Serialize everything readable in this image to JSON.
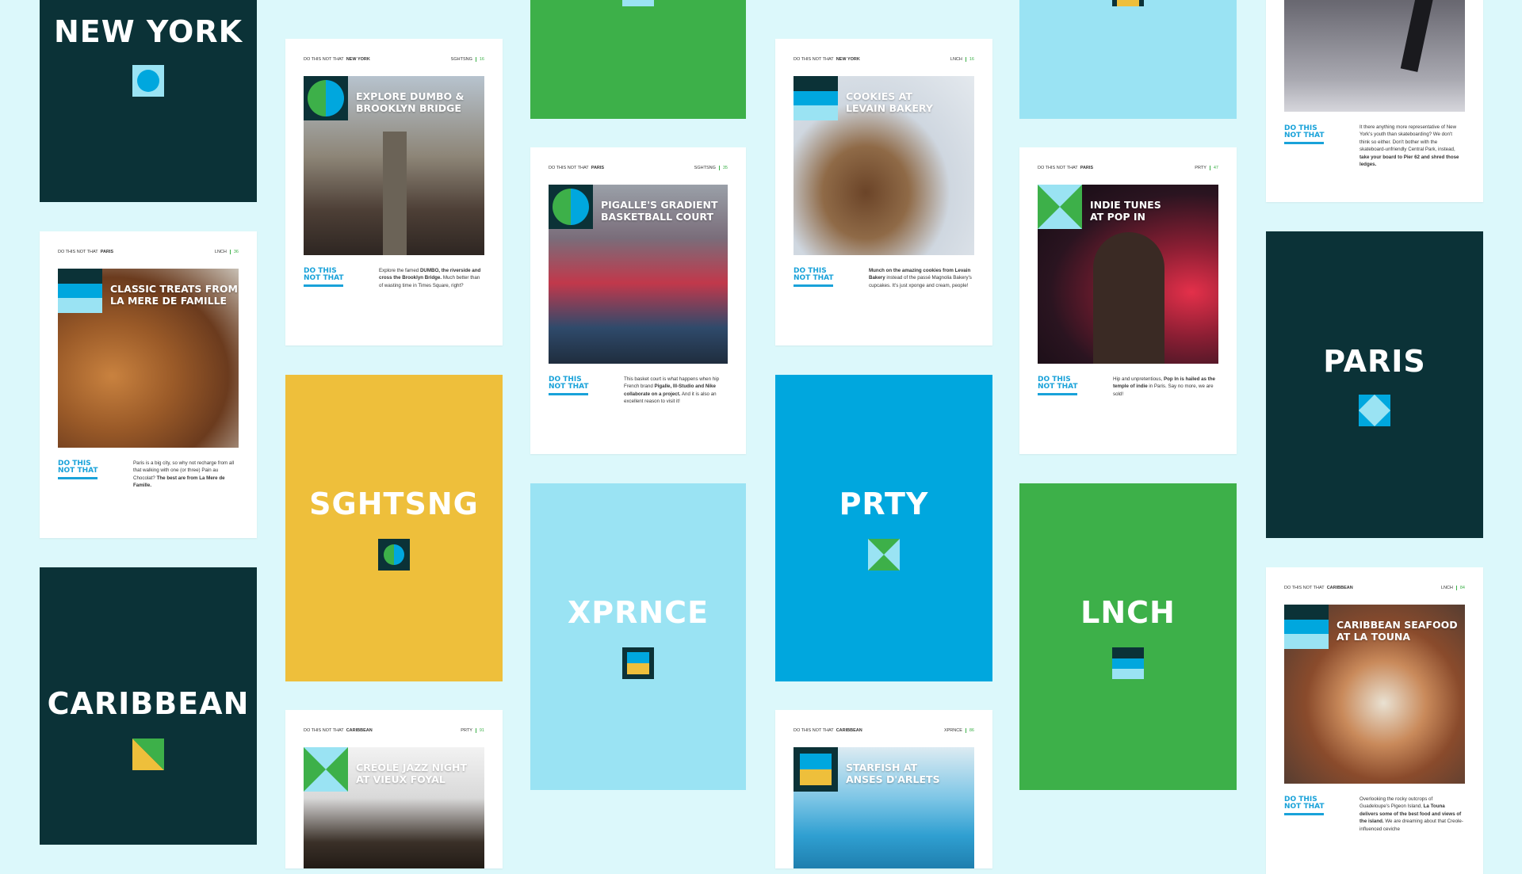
{
  "brand": "DO THIS NOT THAT",
  "dtnt_label": "DO THIS\nNOT THAT",
  "colors": {
    "dark": "#0b3237",
    "green": "#3db049",
    "yellow": "#eebf3b",
    "blue": "#00a7de",
    "light_blue": "#9ae3f3",
    "accent_blue": "#19a2d9",
    "background": "#dcf8fb"
  },
  "covers": {
    "new_york": "NEW YORK",
    "paris": "PARIS",
    "caribbean": "CARIBBEAN",
    "sghtsng": "SGHTSNG",
    "xprnce": "XPRNCE",
    "prty": "PRTY",
    "lnch": "LNCH"
  },
  "pages": {
    "paris_lnch": {
      "city": "PARIS",
      "section": "LNCH",
      "page": "36",
      "title": "CLASSIC TREATS FROM\nLA MERE DE FAMILLE",
      "text_1": "Paris is a big city, so why not recharge from all that walking with one (or three) Pain au Chocolat? ",
      "text_bold": "The best are from La Mere de Famille."
    },
    "ny_sghtsng": {
      "city": "NEW YORK",
      "section": "SGHTSNG",
      "page": "16",
      "title": "EXPLORE DUMBO &\nBROOKLYN BRIDGE",
      "text_1": "Explore the famed ",
      "text_bold": "DUMBO, the riverside and cross the Brooklyn Bridge.",
      "text_2": " Much better than of wasting time in Times Square, right?"
    },
    "paris_sghtsng": {
      "city": "PARIS",
      "section": "SGHTSNG",
      "page": "35",
      "title": "PIGALLE'S GRADIENT\nBASKETBALL COURT",
      "text_1": "This basket court is what happens when hip French brand ",
      "text_bold": "Pigalle, Ill-Studio and Nike collaborate on a project.",
      "text_2": " And it is also an excellent reason to visit it!"
    },
    "ny_lnch": {
      "city": "NEW YORK",
      "section": "LNCH",
      "page": "16",
      "title": "COOKIES AT\nLEVAIN BAKERY",
      "text_bold": "Munch on the amazing cookies from Levain Bakery",
      "text_2": " instead of the passé Magnolia Bakery's cupcakes. It's just xponge and cream, people!"
    },
    "paris_prty": {
      "city": "PARIS",
      "section": "PRTY",
      "page": "47",
      "title": "INDIE TUNES\nAT POP IN",
      "text_1": "Hip and unpretentious, ",
      "text_bold": "Pop In is hailed as the temple of indie",
      "text_2": " in Paris. Say no more, we are sold!"
    },
    "ny_skate": {
      "text_1": "It there anything more representative of New York's youth than skateboarding? We don't think so either. Don't bother with the skateboard-unfriendly Central Park, instead, ",
      "text_bold": "take your board to Pier 62 and shred those ledges."
    },
    "carib_lnch": {
      "city": "CARIBBEAN",
      "section": "LNCH",
      "page": "84",
      "title": "CARIBBEAN SEAFOOD\nAT LA TOUNA",
      "text_1": "Overlooking the rocky outcrops of Guadeloupe's Pigeon Island, ",
      "text_bold": "La Touna delivers some of the best food and views of the island.",
      "text_2": " We are dreaming about that Creole-influenced ceviche"
    },
    "carib_prty": {
      "city": "CARIBBEAN",
      "section": "PRTY",
      "page": "91",
      "title": "CREOLE JAZZ NIGHT\nAT VIEUX FOYAL"
    },
    "carib_xprnce": {
      "city": "CARIBBEAN",
      "section": "XPRNCE",
      "page": "86",
      "title": "STARFISH AT\nANSES D'ARLETS"
    }
  }
}
